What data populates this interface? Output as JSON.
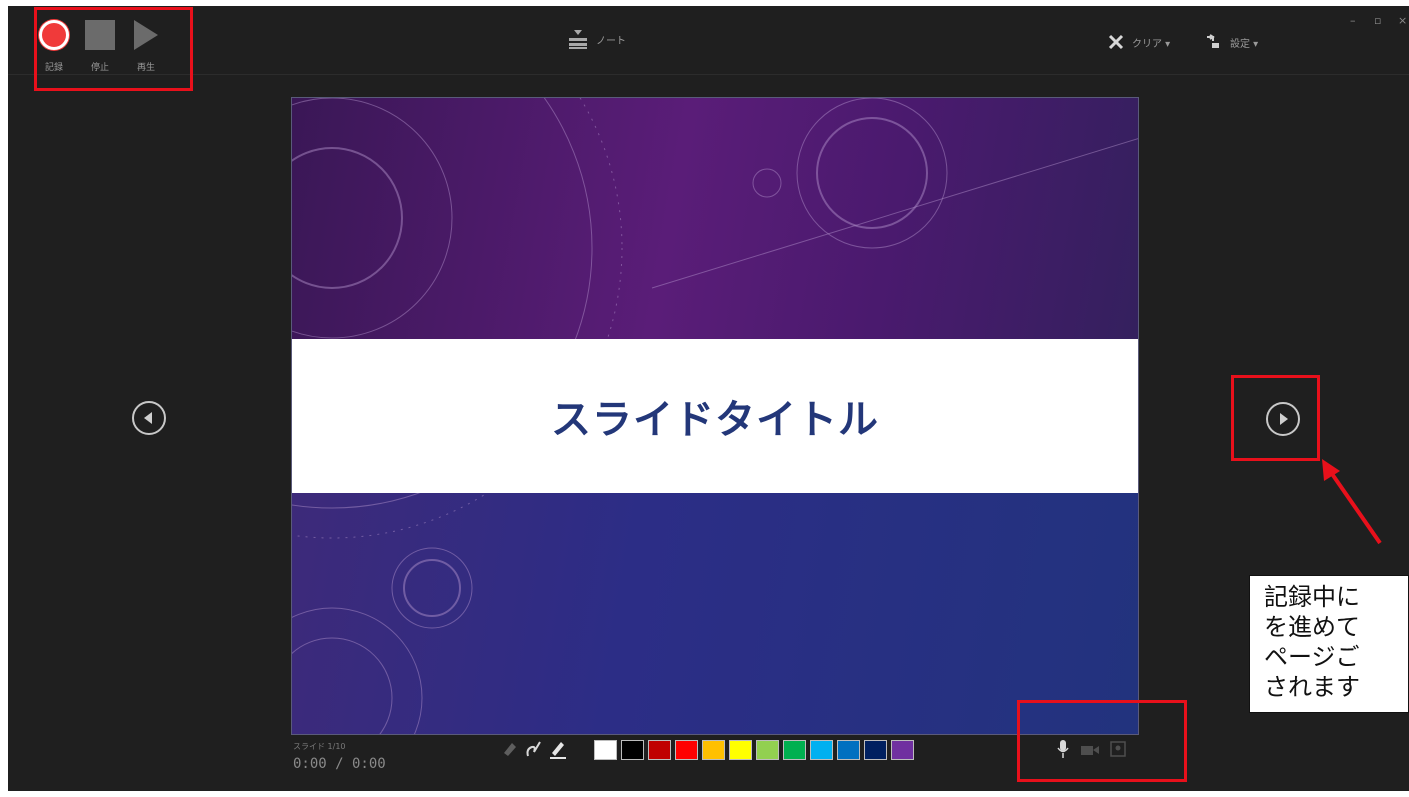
{
  "toolbar": {
    "record_label": "記録",
    "stop_label": "停止",
    "play_label": "再生",
    "notes_label": "ノート",
    "clear_label": "クリア ▾",
    "settings_label": "設定 ▾",
    "window_controls": [
      "–",
      "▫",
      "×"
    ]
  },
  "slide": {
    "title": "スライドタイトル"
  },
  "timer": {
    "label": "スライド 1/10",
    "value": "0:00 / 0:00"
  },
  "pens": [
    "eraser-icon",
    "pen-icon",
    "highlighter-icon"
  ],
  "colors": [
    "#ffffff",
    "#000000",
    "#c00000",
    "#ff0000",
    "#ffc000",
    "#ffff00",
    "#92d050",
    "#00b050",
    "#00b0f0",
    "#0070c0",
    "#002060",
    "#7030a0"
  ],
  "media": [
    "microphone-icon",
    "camera-icon",
    "camera-preview-icon"
  ],
  "callout": {
    "lines": [
      "記録中に",
      "を進めて",
      "ページご",
      "されます"
    ]
  },
  "annotation_color": "#e8101b"
}
